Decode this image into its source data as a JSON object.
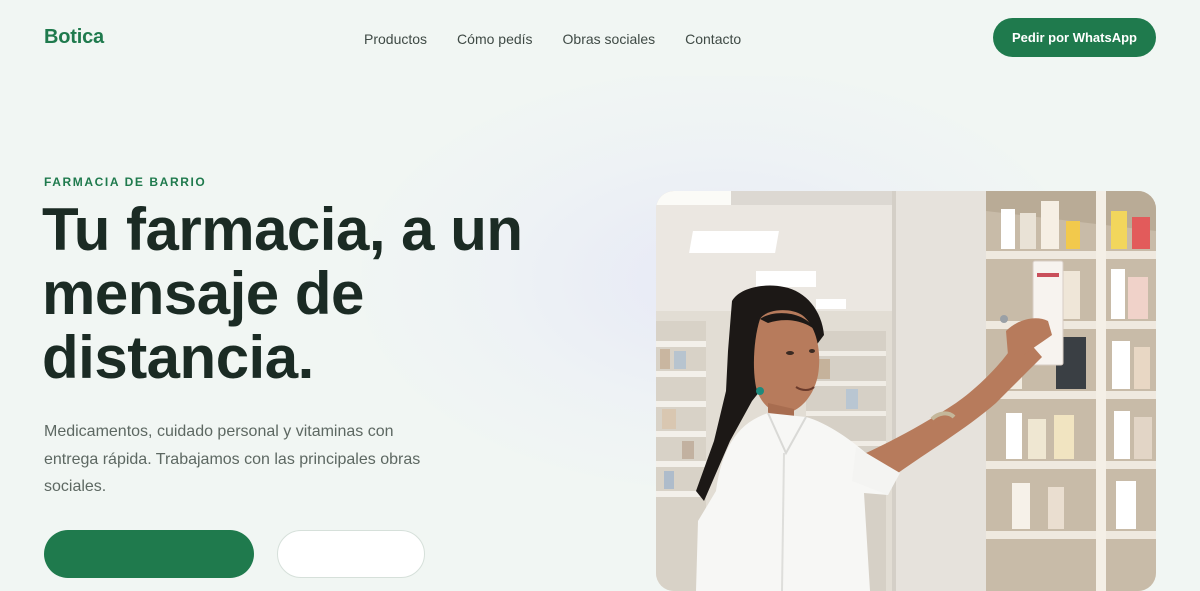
{
  "header": {
    "brand": "Botica",
    "nav": [
      "Productos",
      "Cómo pedís",
      "Obras sociales",
      "Contacto"
    ],
    "cta_label": "Pedir por WhatsApp"
  },
  "hero": {
    "eyebrow": "FARMACIA DE BARRIO",
    "title_lines": [
      "Tu farmacia, a un",
      "mensaje de",
      "distancia."
    ],
    "subtitle": "Medicamentos, cuidado personal y vitaminas con entrega rápida. Trabajamos con las principales obras sociales.",
    "image_icon": "pharmacist-photo"
  },
  "colors": {
    "accent": "#1f7a4d",
    "heading": "#1b2b24",
    "body_text": "#5d6862",
    "background": "#f1f6f3"
  }
}
